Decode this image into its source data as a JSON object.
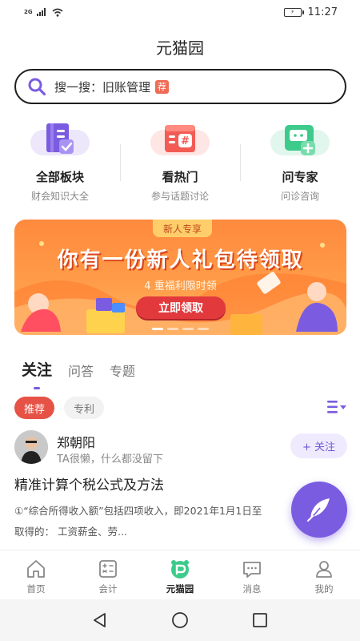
{
  "status_bar": {
    "network": "2G",
    "time": "11:27"
  },
  "header": {
    "title": "元猫园"
  },
  "search": {
    "text": "搜一搜：旧账管理",
    "badge": "荐"
  },
  "shortcuts": [
    {
      "title": "全部板块",
      "subtitle": "财会知识大全",
      "icon": "book-check-icon",
      "color": "#7b5ce0"
    },
    {
      "title": "看热门",
      "subtitle": "参与话题讨论",
      "icon": "hot-topic-icon",
      "color": "#f25c54"
    },
    {
      "title": "问专家",
      "subtitle": "问诊咨询",
      "icon": "chat-plus-icon",
      "color": "#3ccb8b"
    }
  ],
  "banner": {
    "tag": "新人专享",
    "title": "你有一份新人礼包待领取",
    "subtitle": "4 重福利限时领",
    "button": "立即领取"
  },
  "feed_tabs": [
    "关注",
    "问答",
    "专题"
  ],
  "chips": [
    "推荐",
    "专利"
  ],
  "post": {
    "author": "郑朝阳",
    "bio": "TA很懒，什么都没留下",
    "follow": "+ 关注",
    "title": "精准计算个税公式及方法",
    "excerpt_line1": "①“综合所得收入额”包括四项收入，即2021年1月1日至",
    "excerpt_line2": "取得的：      工资薪金、劳..."
  },
  "bottom_nav": [
    {
      "label": "首页",
      "icon": "home-icon"
    },
    {
      "label": "会计",
      "icon": "calculator-icon"
    },
    {
      "label": "元猫园",
      "icon": "yuanmaoyuan-icon",
      "active": true
    },
    {
      "label": "消息",
      "icon": "message-icon"
    },
    {
      "label": "我的",
      "icon": "user-icon"
    }
  ],
  "colors": {
    "accent": "#7a5ce0",
    "chip_active": "#e65246",
    "banner": "#ff8a3d"
  }
}
